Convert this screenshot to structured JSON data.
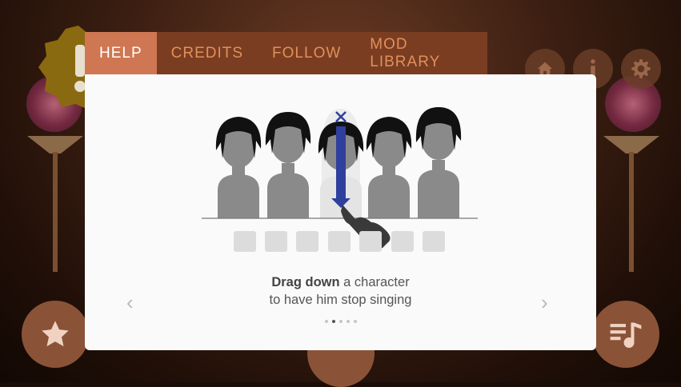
{
  "tabs": [
    {
      "label": "HELP",
      "active": true
    },
    {
      "label": "CREDITS",
      "active": false
    },
    {
      "label": "FOLLOW",
      "active": false
    },
    {
      "label": "MOD LIBRARY",
      "active": false
    }
  ],
  "help": {
    "caption_bold": "Drag down",
    "caption_rest": " a character",
    "caption_line2": "to have him stop singing",
    "page_index": 2,
    "page_count": 5
  },
  "icons": {
    "home": "home-icon",
    "info": "info-icon",
    "settings": "gear-icon",
    "favorite": "star-icon",
    "playlist": "playlist-icon",
    "warning": "warning-icon"
  },
  "colors": {
    "tab_bar": "#7a3d22",
    "tab_active": "#cf7752",
    "tab_text": "#e0905a",
    "panel": "#fafafa",
    "arrow_blue": "#2f3f9e",
    "character": "#888888"
  }
}
